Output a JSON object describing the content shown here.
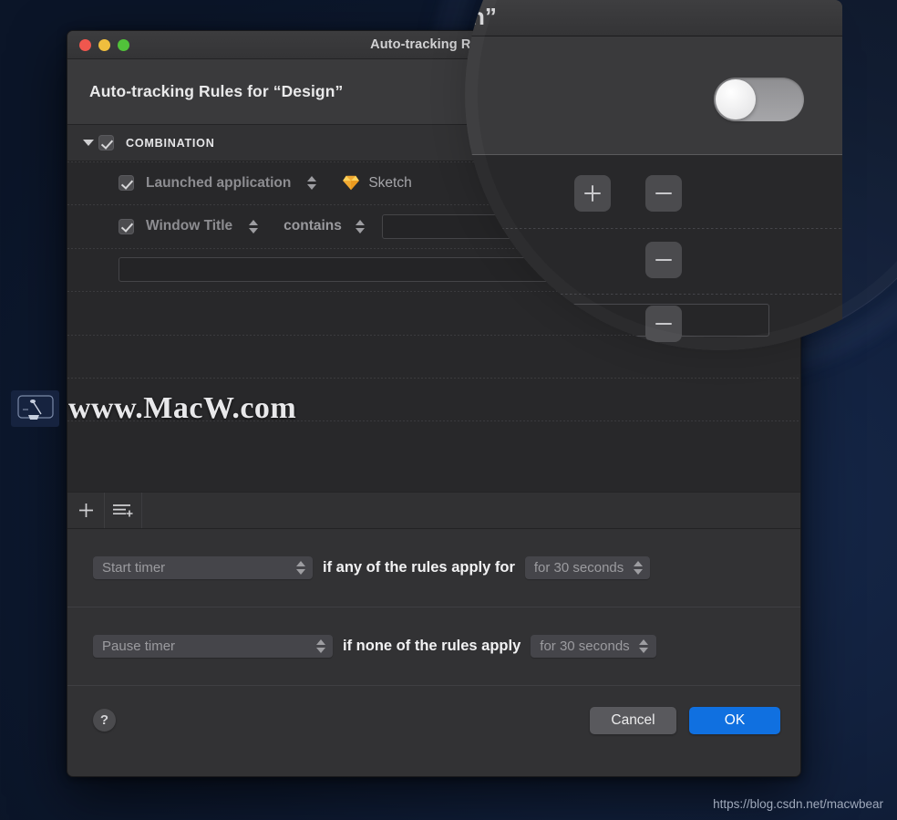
{
  "window": {
    "title": "Auto-tracking Rules for “Design”",
    "title_visible": "Auto-tracking Rules ",
    "header_title": "Auto-tracking Rules for “Design”",
    "traffic_lights": [
      "close-red",
      "minimize-yellow",
      "zoom-green"
    ],
    "colors": {
      "titlebar": "#3a3a3c",
      "header": "#3a3a3c",
      "list_background": "#28282a",
      "accent_ok": "#1070e0",
      "sketch_gold": "#f7b500"
    }
  },
  "rules": {
    "group": {
      "label": "COMBINATION",
      "checked": true,
      "expanded": true,
      "add_label": "+",
      "remove_label": "−"
    },
    "items": [
      {
        "checked": true,
        "field": "Launched application",
        "value_icon": "sketch-diamond-icon",
        "value": "Sketch",
        "remove_label": "−"
      },
      {
        "checked": true,
        "field": "Window Title",
        "operator": "contains",
        "value": "",
        "remove_label": "−"
      },
      {
        "checked": false,
        "field": "",
        "value": "",
        "remove_label": "−"
      }
    ]
  },
  "list_toolbar": {
    "add_rule_label": "+",
    "add_rule_icon": "plus-icon",
    "add_group_icon": "add-group-icon"
  },
  "timers": [
    {
      "action": "Start timer",
      "condition": "if any of the rules apply for",
      "duration": "for 30 seconds"
    },
    {
      "action": "Pause timer",
      "condition": "if none of the rules apply",
      "duration": "for 30 seconds"
    }
  ],
  "footer": {
    "help_label": "?",
    "cancel_label": "Cancel",
    "ok_label": "OK"
  },
  "magnifier": {
    "title_fragment": "n”",
    "toggle_state": "off"
  },
  "watermark": {
    "text": "www.MacW.com",
    "logo_icon": "macw-logo-icon"
  },
  "blog_url": "https://blog.csdn.net/macwbear"
}
